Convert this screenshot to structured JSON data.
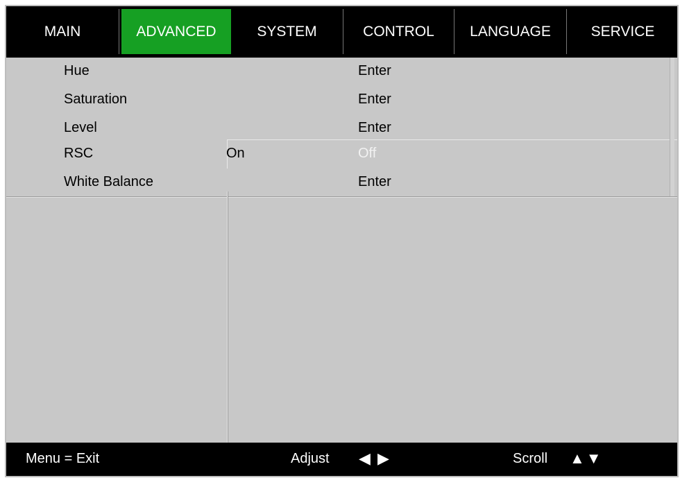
{
  "tabs": [
    {
      "label": "MAIN",
      "active": false
    },
    {
      "label": "ADVANCED",
      "active": true
    },
    {
      "label": "SYSTEM",
      "active": false
    },
    {
      "label": "CONTROL",
      "active": false
    },
    {
      "label": "LANGUAGE",
      "active": false
    },
    {
      "label": "SERVICE",
      "active": false
    }
  ],
  "menu": {
    "items": [
      {
        "label": "Hue",
        "value": "Enter"
      },
      {
        "label": "Saturation",
        "value": "Enter"
      },
      {
        "label": "Level",
        "value": "Enter"
      },
      {
        "label": "RSC",
        "options": [
          "On",
          "Off"
        ],
        "selected": "On"
      },
      {
        "label": "White Balance",
        "value": "Enter"
      }
    ]
  },
  "footer": {
    "exit": "Menu = Exit",
    "adjust": "Adjust",
    "adjust_icon": "◀ ▶",
    "scroll": "Scroll",
    "scroll_icon": "▲▼"
  },
  "colors": {
    "active_tab": "#16a023",
    "background": "#c8c8c8",
    "bar": "#000000"
  }
}
